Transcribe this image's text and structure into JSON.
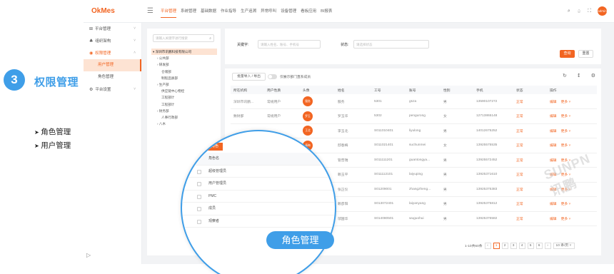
{
  "intro": {
    "step_number": "3",
    "title": "权限管理",
    "bullets": [
      "角色管理",
      "用户管理"
    ]
  },
  "app": {
    "logo": "OkMes",
    "top_nav": [
      "平台管理",
      "系统管理",
      "基础数据",
      "作业指导",
      "生产追溯",
      "异常呼叫",
      "设备管理",
      "看板应用",
      "BI报表"
    ],
    "avatar_text": "admin",
    "sidebar": {
      "items": [
        {
          "icon": "平",
          "label": "平台管理"
        },
        {
          "icon": "组",
          "label": "组织架构"
        },
        {
          "icon": "权",
          "label": "权限管理",
          "open": true
        },
        {
          "icon": "平",
          "label": "平台设置"
        }
      ],
      "sub_items": [
        "用户管理",
        "角色管理"
      ],
      "collapse": "▷"
    },
    "tree": {
      "search_placeholder": "请输入关键字进行搜索",
      "nodes": [
        {
          "label": "▾ 深圳市讯鹏科技有限公司",
          "indent": 0,
          "root": true
        },
        {
          "label": "› 公共部",
          "indent": 1
        },
        {
          "label": "› 研发部",
          "indent": 1
        },
        {
          "label": "仓储部",
          "indent": 2
        },
        {
          "label": "制程品质部",
          "indent": 2
        },
        {
          "label": "› 生产部",
          "indent": 1
        },
        {
          "label": "供应链中心物控",
          "indent": 2
        },
        {
          "label": "工程部计",
          "indent": 2
        },
        {
          "label": "工程部计",
          "indent": 2
        },
        {
          "label": "› 财务部",
          "indent": 1
        },
        {
          "label": "人事行政部",
          "indent": 2
        },
        {
          "label": "› 八木",
          "indent": 1
        }
      ]
    },
    "filter": {
      "keyword_label": "关键字:",
      "keyword_placeholder": "请输入姓名、账号、手机号",
      "status_label": "状态:",
      "status_placeholder": "请选择状态",
      "query_label": "查询",
      "reset_label": "重置"
    },
    "table_toolbar": {
      "import_label": "批量导入 / 导出",
      "toggle_label": "仅展示部门直系成员"
    },
    "table": {
      "columns": [
        "所在机构",
        "用户性质",
        "头像",
        "姓名",
        "工号",
        "账号",
        "性别",
        "手机",
        "状态",
        "操作"
      ],
      "rows": [
        {
          "org": "深圳市讯鹏...",
          "type": "常规用户",
          "avatar": "服务",
          "name": "服务",
          "no": "5301",
          "account": "gsza",
          "gender": "男",
          "phone": "13590107272",
          "status": "正常",
          "op1": "编辑",
          "op2": "更多 ˅"
        },
        {
          "org": "数财部",
          "type": "常规用户",
          "avatar": "罗玉",
          "name": "罗玉华",
          "no": "5302",
          "account": "pengurong",
          "gender": "女",
          "phone": "12713865148",
          "status": "正常",
          "op1": "编辑",
          "op2": "更多 ˅"
        },
        {
          "org": "",
          "type": "",
          "avatar": "王北",
          "name": "李玉北",
          "no": "S011010401",
          "account": "liyulong",
          "gender": "男",
          "phone": "14012675252",
          "status": "正常",
          "op1": "编辑",
          "op2": "更多 ˅"
        },
        {
          "org": "",
          "type": "",
          "avatar": "春梅",
          "name": "邸春梅",
          "no": "S011021401",
          "account": "suchunmei",
          "gender": "女",
          "phone": "13925575535",
          "status": "正常",
          "op1": "编辑",
          "op2": "更多 ˅"
        },
        {
          "org": "",
          "type": "",
          "avatar": "管理",
          "name": "管普瑞",
          "no": "S011111201",
          "account": "guantongya...",
          "gender": "男",
          "phone": "13925572452",
          "status": "正常",
          "op1": "编辑",
          "op2": "更多 ˅"
        },
        {
          "org": "",
          "type": "",
          "avatar": "玉平",
          "name": "赖玉平",
          "no": "S011112101",
          "account": "laiyuping",
          "gender": "男",
          "phone": "13925371610",
          "status": "正常",
          "op1": "编辑",
          "op2": "更多 ˅"
        },
        {
          "org": "",
          "type": "",
          "avatar": "正仪",
          "name": "张正仪",
          "no": "S01209001",
          "account": "zhangzheng...",
          "gender": "男",
          "phone": "13925375383",
          "status": "正常",
          "op1": "编辑",
          "op2": "更多 ˅"
        },
        {
          "org": "",
          "type": "",
          "avatar": "彦阳",
          "name": "赖彦阳",
          "no": "S013072401",
          "account": "laiyanyang",
          "gender": "男",
          "phone": "13925375812",
          "status": "正常",
          "op1": "编辑",
          "op2": "更多 ˅"
        },
        {
          "org": "",
          "type": "",
          "avatar": "国华",
          "name": "邬国华",
          "no": "S014080501",
          "account": "wuguohui",
          "gender": "男",
          "phone": "13925376582",
          "status": "正常",
          "op1": "编辑",
          "op2": "更多 ˅"
        }
      ]
    },
    "pager": {
      "summary": "1-10共60条",
      "prev": "‹",
      "pages": [
        "1",
        "2",
        "3",
        "4",
        "5",
        "6"
      ],
      "next": "›",
      "page_size": "10 条/页 ˅"
    },
    "watermark": "SUNPN讯鹏"
  },
  "lens": {
    "tab_label": "全部角色",
    "rows": [
      "角色名",
      "超级管理员",
      "用户管理员",
      "PMC",
      "成员",
      "观察者"
    ],
    "badge": "角色管理"
  },
  "colors": {
    "accent": "#f26522",
    "brand_blue": "#3f9ee8"
  }
}
